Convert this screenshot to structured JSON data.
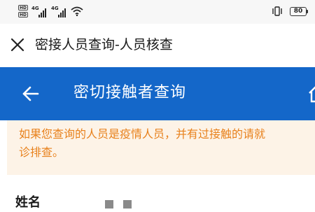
{
  "status_bar": {
    "hd_tags": [
      "HD",
      "HD"
    ],
    "network_1": "4G",
    "network_2": "4G",
    "battery": "80",
    "icons": [
      "signal-icon",
      "wifi-icon",
      "vibrate-icon",
      "battery-icon"
    ]
  },
  "web_header": {
    "title": "密接人员查询-人员核查",
    "close_icon": "close-icon"
  },
  "app_bar": {
    "title": "密切接触者查询",
    "color": "#1467c9",
    "back_icon": "back-arrow-icon",
    "home_icon": "home-icon"
  },
  "notice": {
    "line1": "如果您查询的人员是疫情人员，并有过接触的请就",
    "line2": "诊排查。",
    "text_color": "#e8811c",
    "background": "#fdf3e7"
  },
  "form": {
    "name_label": "姓名",
    "name_value_masked": true
  }
}
